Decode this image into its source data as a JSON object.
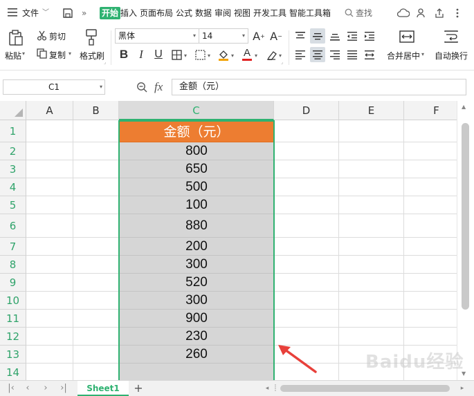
{
  "menu": {
    "file": "文件",
    "tabs": [
      "开始",
      "插入",
      "页面布局",
      "公式",
      "数据",
      "审阅",
      "视图",
      "开发工具",
      "智能工具箱"
    ],
    "search": "查找"
  },
  "ribbon": {
    "paste": "粘贴",
    "cut": "剪切",
    "copy": "复制",
    "format_painter": "格式刷",
    "font_name": "黑体",
    "font_size": "14",
    "bold": "B",
    "italic": "I",
    "underline": "U",
    "font_color_glyph": "A",
    "merge_center": "合并居中",
    "wrap_text": "自动换行"
  },
  "formula_bar": {
    "name_box": "C1",
    "fx": "fx",
    "content": "金额（元）"
  },
  "sheet": {
    "columns": [
      "A",
      "B",
      "C",
      "D",
      "E",
      "F"
    ],
    "rows": [
      "1",
      "2",
      "3",
      "4",
      "5",
      "6",
      "7",
      "8",
      "9",
      "10",
      "11",
      "12",
      "13",
      "14"
    ],
    "column_c": [
      "金额（元）",
      "800",
      "650",
      "500",
      "100",
      "880",
      "200",
      "300",
      "520",
      "300",
      "900",
      "230",
      "260",
      ""
    ],
    "header_fill": "#ED7D31",
    "selection_fill": "#D6D6D6",
    "accent": "#2FB271"
  },
  "sheet_tabs": {
    "active": "Sheet1",
    "add": "+"
  },
  "watermark": "Baidu经验"
}
